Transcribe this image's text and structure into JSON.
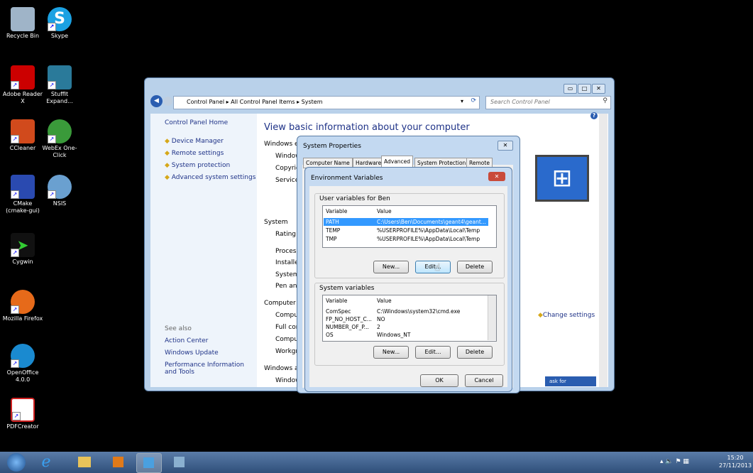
{
  "desktop_icons": [
    {
      "label": "Recycle Bin",
      "icon": "recycle-bin-icon",
      "color": "#9fb4c8"
    },
    {
      "label": "Skype",
      "icon": "skype-icon",
      "color": "#1ba1e2"
    },
    {
      "label": "Adobe Reader X",
      "icon": "adobe-reader-icon",
      "color": "#c00"
    },
    {
      "label": "StuffIt Expand...",
      "icon": "stuffit-icon",
      "color": "#2a7a9a"
    },
    {
      "label": "CCleaner",
      "icon": "ccleaner-icon",
      "color": "#d14a1c"
    },
    {
      "label": "WebEx One-Click",
      "icon": "webex-icon",
      "color": "#3a9a3a"
    },
    {
      "label": "CMake (cmake-gui)",
      "icon": "cmake-icon",
      "color": "#2a4ab0"
    },
    {
      "label": "NSIS",
      "icon": "nsis-icon",
      "color": "#6aa0d0"
    },
    {
      "label": "Cygwin",
      "icon": "cygwin-icon",
      "color": "#111"
    },
    {
      "label": "Mozilla Firefox",
      "icon": "firefox-icon",
      "color": "#e66a1a"
    },
    {
      "label": "OpenOffice 4.0.0",
      "icon": "openoffice-icon",
      "color": "#1a8ad0"
    },
    {
      "label": "PDFCreator",
      "icon": "pdfcreator-icon",
      "color": "#d02020"
    }
  ],
  "cp_window": {
    "address": "Control Panel ▸ All Control Panel Items ▸ System",
    "search_placeholder": "Search Control Panel",
    "left_home": "Control Panel Home",
    "left_links": [
      "Device Manager",
      "Remote settings",
      "System protection",
      "Advanced system settings"
    ],
    "see_also": "See also",
    "see_also_links": [
      "Action Center",
      "Windows Update",
      "Performance Information and Tools"
    ],
    "heading": "View basic information about your computer",
    "section1": "Windows ed",
    "s1_items": [
      "Window",
      "Copyrig",
      "Service"
    ],
    "section2": "System",
    "s2_items": [
      "Rating:",
      "Process",
      "Installed",
      "System",
      "Pen and"
    ],
    "section3": "Computer r",
    "s3_items": [
      "Compu",
      "Full con",
      "Compu",
      "Workgr"
    ],
    "section4": "Windows ac",
    "s4_items": [
      "Window"
    ],
    "change_settings": "Change settings",
    "ask_for": "ask for"
  },
  "sys_props": {
    "title": "System Properties",
    "tabs": [
      "Computer Name",
      "Hardware",
      "Advanced",
      "System Protection",
      "Remote"
    ],
    "active_tab": "Advanced"
  },
  "env_vars": {
    "title": "Environment Variables",
    "user_group": "User variables for Ben",
    "col_var": "Variable",
    "col_val": "Value",
    "user_rows": [
      {
        "var": "PATH",
        "val": "C:\\Users\\Ben\\Documents\\geant4\\geant..."
      },
      {
        "var": "TEMP",
        "val": "%USERPROFILE%\\AppData\\Local\\Temp"
      },
      {
        "var": "TMP",
        "val": "%USERPROFILE%\\AppData\\Local\\Temp"
      }
    ],
    "sys_group": "System variables",
    "sys_rows": [
      {
        "var": "ComSpec",
        "val": "C:\\Windows\\system32\\cmd.exe"
      },
      {
        "var": "FP_NO_HOST_C...",
        "val": "NO"
      },
      {
        "var": "NUMBER_OF_P...",
        "val": "2"
      },
      {
        "var": "OS",
        "val": "Windows_NT"
      }
    ],
    "btn_new": "New...",
    "btn_edit": "Edit...",
    "btn_delete": "Delete",
    "btn_ok": "OK",
    "btn_cancel": "Cancel"
  },
  "taskbar": {
    "time": "15:20",
    "date": "27/11/2013"
  }
}
